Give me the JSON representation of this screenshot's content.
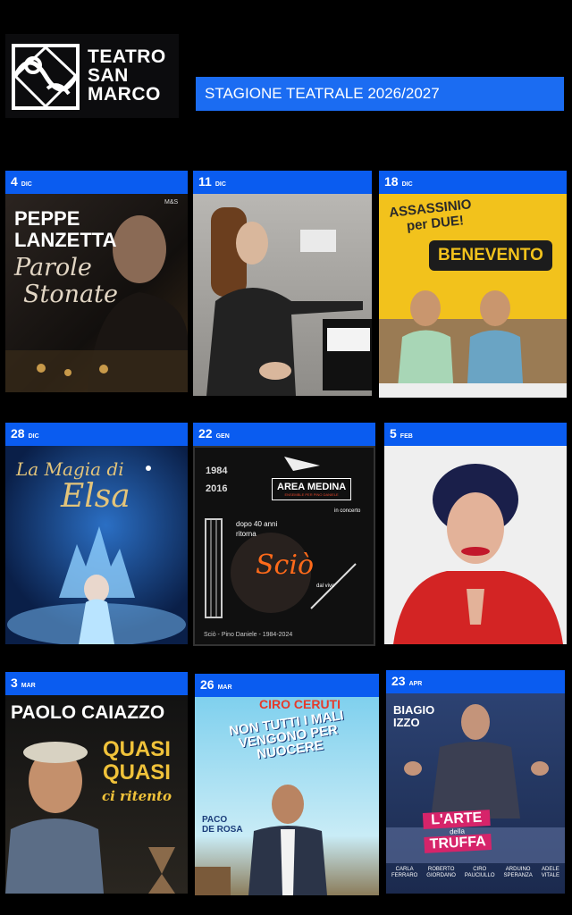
{
  "theatre": {
    "name_line1": "TEATRO",
    "name_line2": "SAN",
    "name_line3": "MARCO"
  },
  "season_title": "STAGIONE TEATRALE 2026/2027",
  "events": [
    {
      "day": "4",
      "month": "DIC",
      "poster": {
        "performer": "PEPPE",
        "performer2": "LANZETTA",
        "title1": "Parole",
        "title2": "Stonate",
        "brand": "M&S"
      }
    },
    {
      "day": "11",
      "month": "DIC",
      "poster": {}
    },
    {
      "day": "18",
      "month": "DIC",
      "poster": {
        "title1": "ASSASSINIO",
        "title2": "per DUE!",
        "city": "BENEVENTO"
      }
    },
    {
      "day": "28",
      "month": "DIC",
      "poster": {
        "title1": "La Magia di",
        "title2": "Elsa"
      }
    },
    {
      "day": "22",
      "month": "GEN",
      "poster": {
        "years_top": "1984",
        "years_bottom": "2016",
        "band": "AREA MEDINA",
        "band_sub": "ENSEMBLE PER PINO DANIELE",
        "concert": "in concerto",
        "after1": "dopo 40 anni",
        "after2": "ritorna",
        "title": "Sciò",
        "live": "dal vivo",
        "footer": "Sciò - Pino Daniele - 1984-2024"
      }
    },
    {
      "day": "5",
      "month": "FEB",
      "poster": {}
    },
    {
      "day": "3",
      "month": "MAR",
      "poster": {
        "performer": "PAOLO CAIAZZO",
        "title1": "QUASI",
        "title2": "QUASI",
        "title3": "ci ritento"
      }
    },
    {
      "day": "26",
      "month": "MAR",
      "poster": {
        "performer": "CIRO CERUTI",
        "title1": "NON TUTTI I MALI",
        "title2": "VENGONO PER",
        "title3": "NUOCERE",
        "director1": "PACO",
        "director2": "DE ROSA"
      }
    },
    {
      "day": "23",
      "month": "APR",
      "poster": {
        "performer1": "BIAGIO",
        "performer2": "IZZO",
        "title1": "L'ARTE",
        "title2": "della",
        "title3": "TRUFFA",
        "cast1": "CARLA",
        "cast1b": "FERRARO",
        "cast2": "ROBERTO",
        "cast2b": "GIORDANO",
        "cast3": "CIRO",
        "cast3b": "PAUCIULLO",
        "cast4": "ARDUINO",
        "cast4b": "SPERANZA",
        "cast5": "ADELE",
        "cast5b": "VITALE"
      }
    }
  ],
  "colors": {
    "background": "#000000",
    "accent_blue": "#0a5cf0",
    "banner_blue": "#1b6cf2"
  },
  "icons": {
    "logo": "theatre-logo-mark"
  }
}
